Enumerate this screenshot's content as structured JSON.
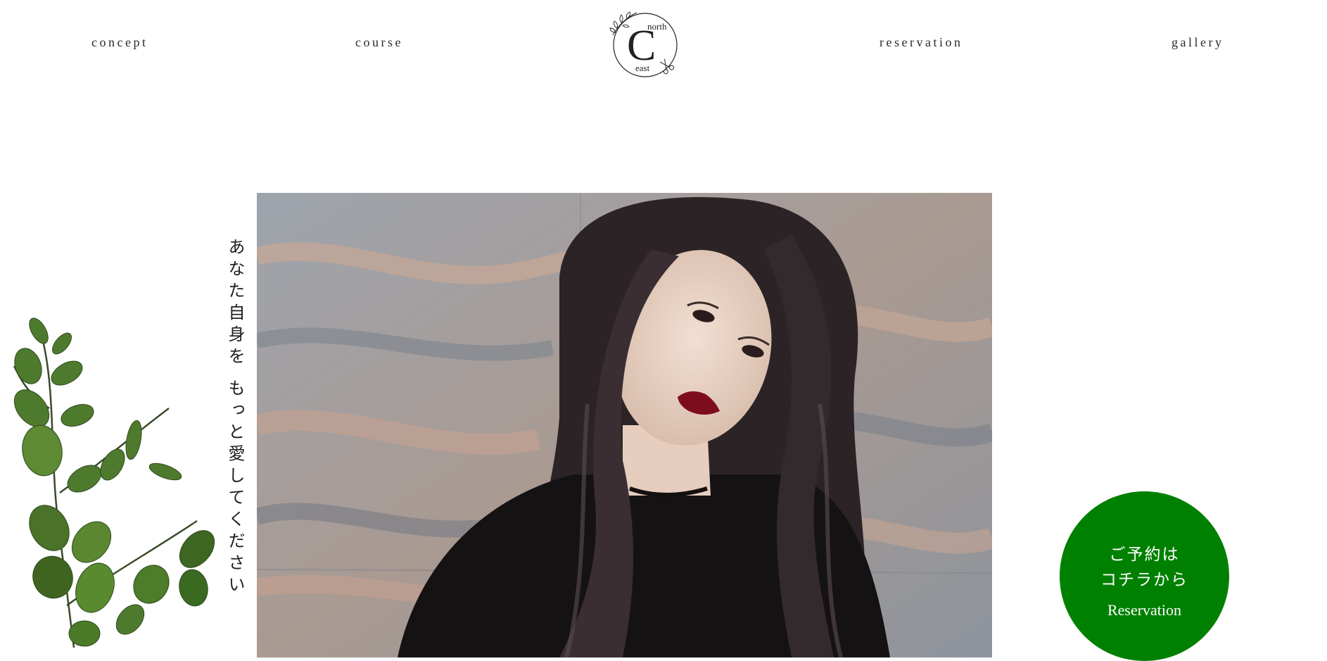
{
  "nav": {
    "concept": "concept",
    "course": "course",
    "reservation": "reservation",
    "gallery": "gallery"
  },
  "logo": {
    "top": "north",
    "letter": "C",
    "bottom": "east"
  },
  "hero": {
    "tagline": "あなた自身を もっと愛してください"
  },
  "reserve_button": {
    "line1": "ご予約は",
    "line2": "コチラから",
    "en": "Reservation",
    "color": "#008000"
  }
}
